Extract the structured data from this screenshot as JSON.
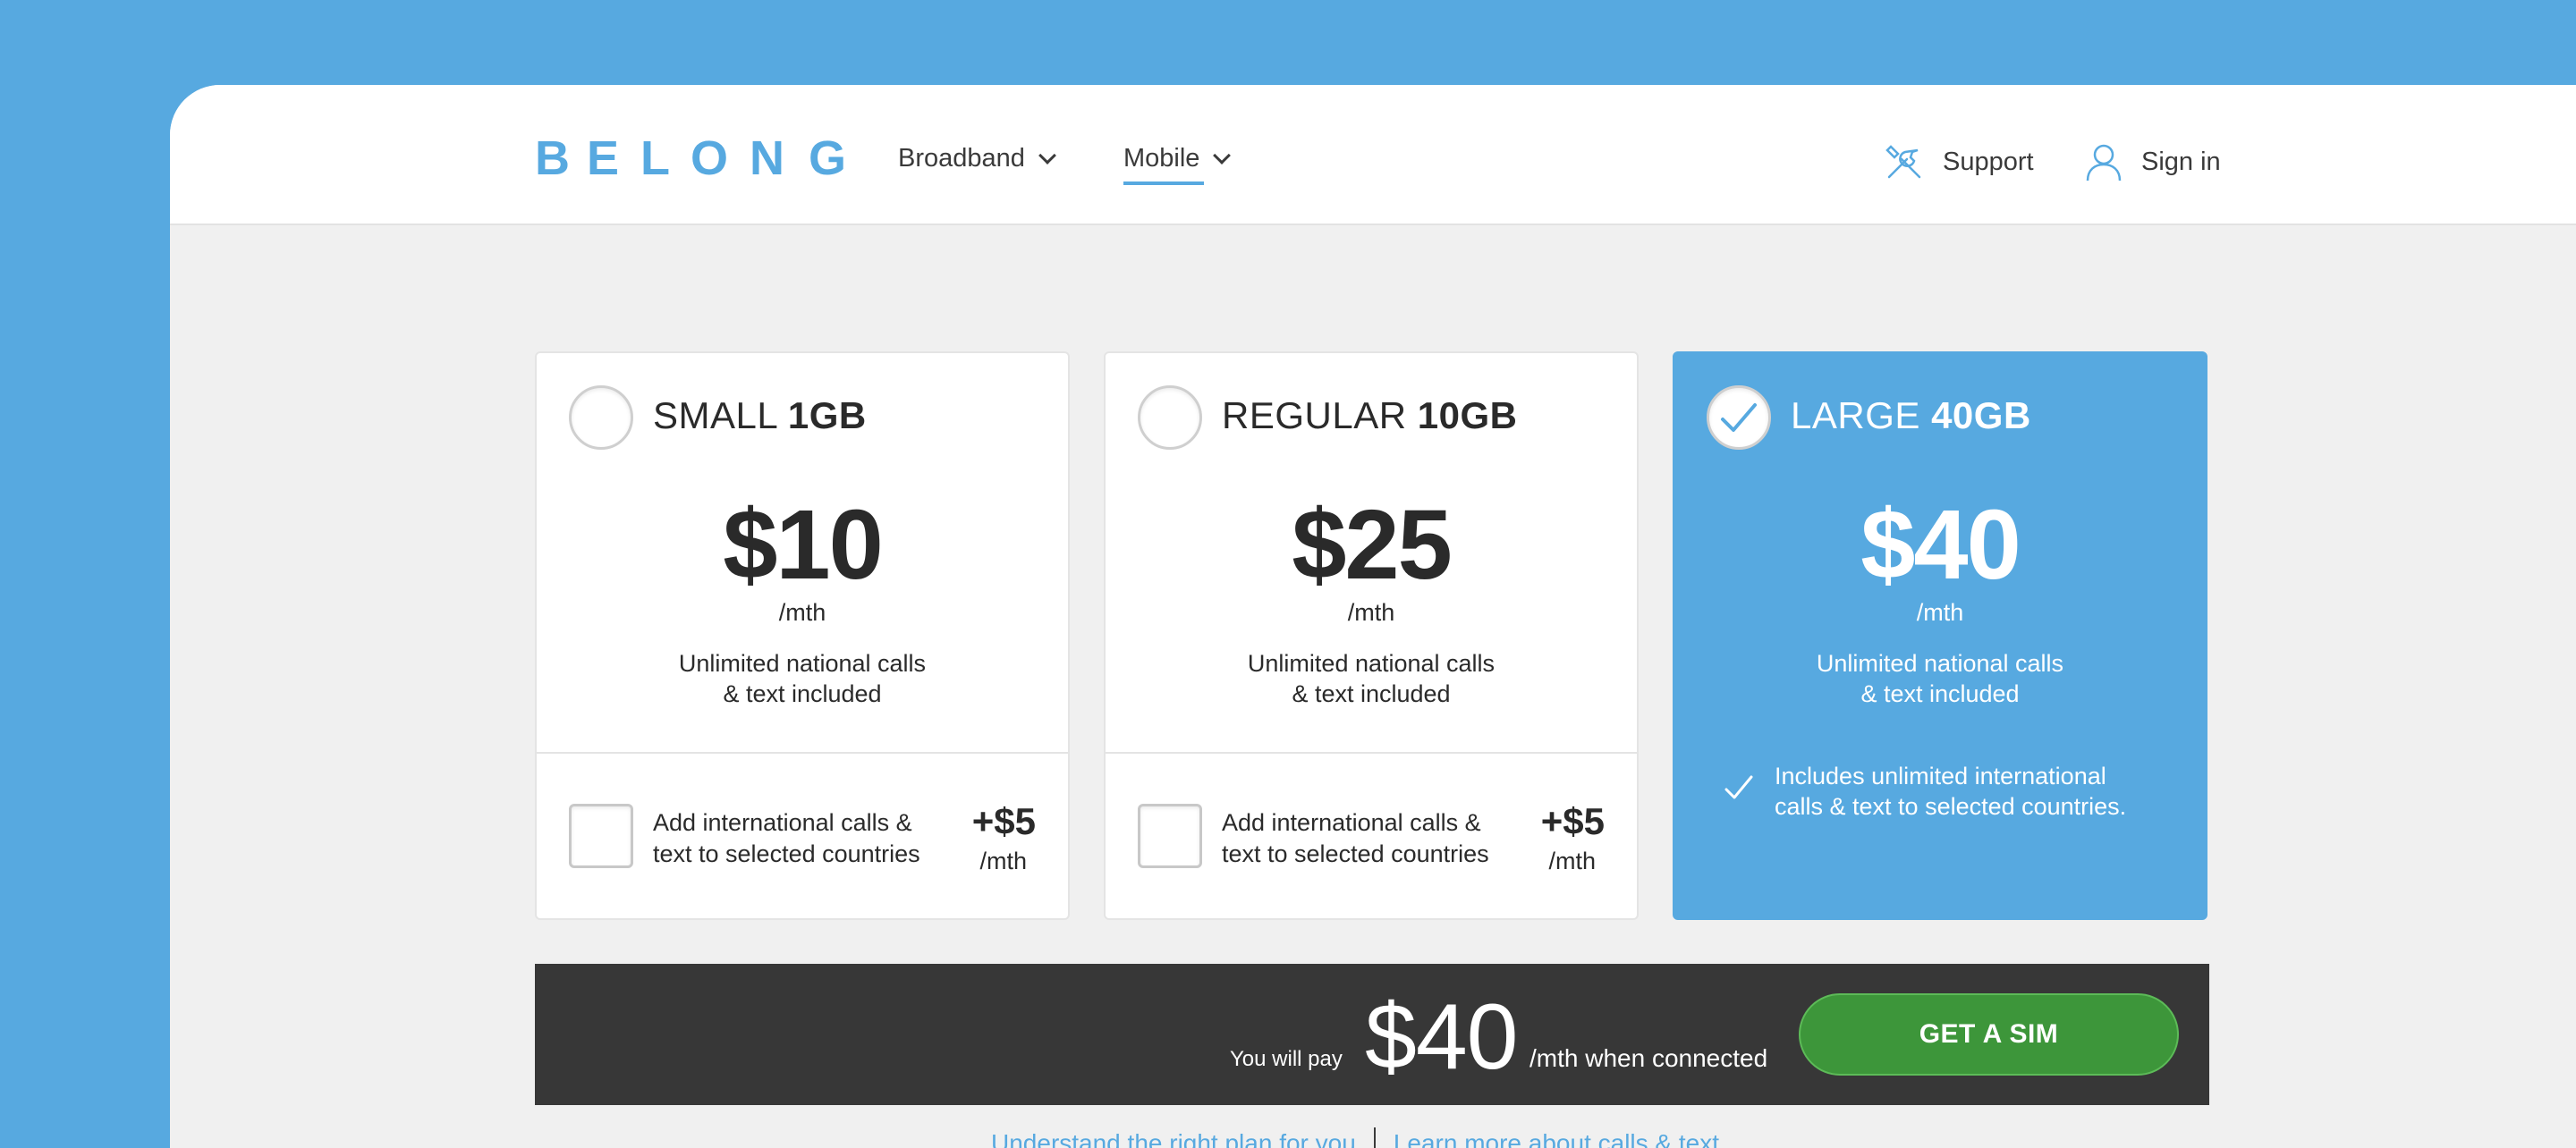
{
  "brand": {
    "logo_letters": [
      "B",
      "Ǝ",
      "L",
      "O",
      "N",
      "G"
    ],
    "accent": "#57a9e0"
  },
  "nav": {
    "items": [
      {
        "label": "Broadband",
        "active": false
      },
      {
        "label": "Mobile",
        "active": true
      }
    ],
    "support": {
      "label": "Support",
      "icon": "tools-icon"
    },
    "signin": {
      "label": "Sign in",
      "icon": "user-icon"
    }
  },
  "plans": [
    {
      "name": "SMALL",
      "data": "1GB",
      "price": "$10",
      "per": "/mth",
      "desc_line1": "Unlimited national calls",
      "desc_line2": "& text included",
      "selected": false,
      "addon_line1": "Add international calls &",
      "addon_line2": "text to selected countries",
      "addon_price": "+$5",
      "addon_per": "/mth"
    },
    {
      "name": "REGULAR",
      "data": "10GB",
      "price": "$25",
      "per": "/mth",
      "desc_line1": "Unlimited national calls",
      "desc_line2": "& text included",
      "selected": false,
      "addon_line1": "Add international calls &",
      "addon_line2": "text to selected countries",
      "addon_price": "+$5",
      "addon_per": "/mth"
    },
    {
      "name": "LARGE",
      "data": "40GB",
      "price": "$40",
      "per": "/mth",
      "desc_line1": "Unlimited national calls",
      "desc_line2": "& text included",
      "selected": true,
      "included_line1": "Includes unlimited international",
      "included_line2": "calls & text to selected countries."
    }
  ],
  "summary": {
    "label": "You will pay",
    "amount": "$40",
    "suffix": "/mth when connected",
    "cta": "GET A SIM",
    "cta_color": "#3d963a"
  },
  "footer_links": [
    "Understand the right plan for you",
    "Learn more about calls & text"
  ]
}
